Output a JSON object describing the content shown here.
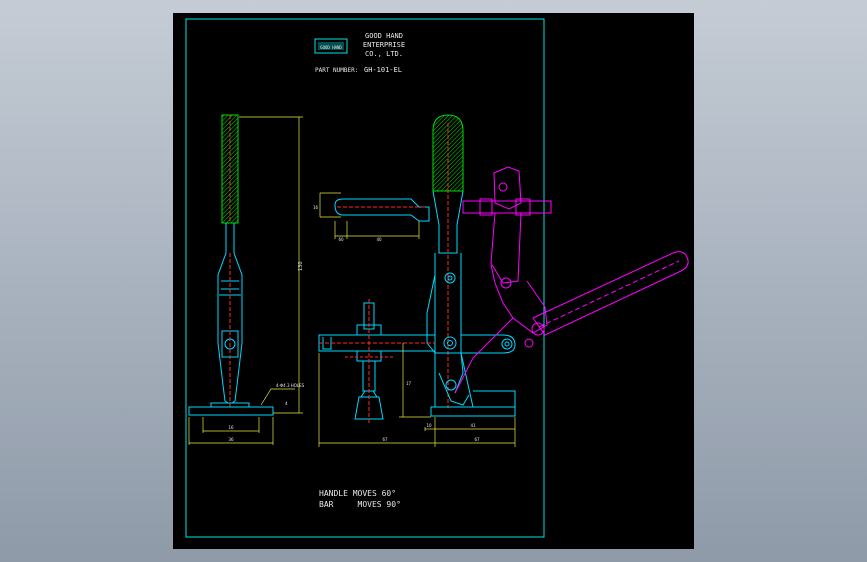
{
  "title_block": {
    "logo_text": "GOOD HAND",
    "company_line1": "GOOD HAND",
    "company_line2": "ENTERPRISE",
    "company_line3": "CO., LTD.",
    "part_number_label": "PART NUMBER:",
    "part_number_value": "GH-101-EL"
  },
  "notes": {
    "line1": "HANDLE MOVES 60°",
    "line2": "BAR     MOVES 90°"
  },
  "dimensions": {
    "overall_height": "130",
    "bolt_width": "16",
    "handle_length": "60",
    "bar_length": "40",
    "base_inner": "16",
    "base_outer": "36",
    "base_hole": "4-Φ4.3 HOLES",
    "thickness": "4",
    "spindle_height": "17",
    "left_width": "67",
    "right_a": "10",
    "right_b": "41",
    "right_c": "67"
  },
  "colors": {
    "frame": "#00e5e5",
    "geometry": "#00d8ff",
    "hatch": "#00e000",
    "hidden": "#ff2a2a",
    "motion": "#ff00ff",
    "dimension": "#e8e84a"
  }
}
